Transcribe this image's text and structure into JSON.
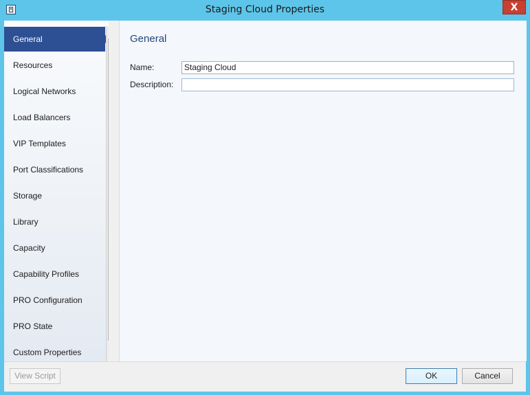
{
  "window": {
    "title": "Staging Cloud Properties",
    "close_glyph": "X",
    "app_icon": "properties-icon"
  },
  "sidebar": {
    "items": [
      {
        "label": "General",
        "selected": true
      },
      {
        "label": "Resources"
      },
      {
        "label": "Logical Networks"
      },
      {
        "label": "Load Balancers"
      },
      {
        "label": "VIP Templates"
      },
      {
        "label": "Port Classifications"
      },
      {
        "label": "Storage"
      },
      {
        "label": "Library"
      },
      {
        "label": "Capacity"
      },
      {
        "label": "Capability Profiles"
      },
      {
        "label": "PRO Configuration"
      },
      {
        "label": "PRO State"
      },
      {
        "label": "Custom Properties"
      }
    ],
    "scroll_up_glyph": "▲",
    "scroll_down_glyph": "▼",
    "grip_glyph": "≡"
  },
  "general": {
    "title": "General",
    "name_label": "Name:",
    "name_value": "Staging Cloud",
    "description_label": "Description:",
    "description_value": ""
  },
  "footer": {
    "view_script": "View Script",
    "ok": "OK",
    "cancel": "Cancel"
  },
  "colors": {
    "window_frame": "#5ec5ea",
    "selected_nav": "#2d4f93",
    "close_button": "#c84031",
    "section_title": "#24477a"
  }
}
